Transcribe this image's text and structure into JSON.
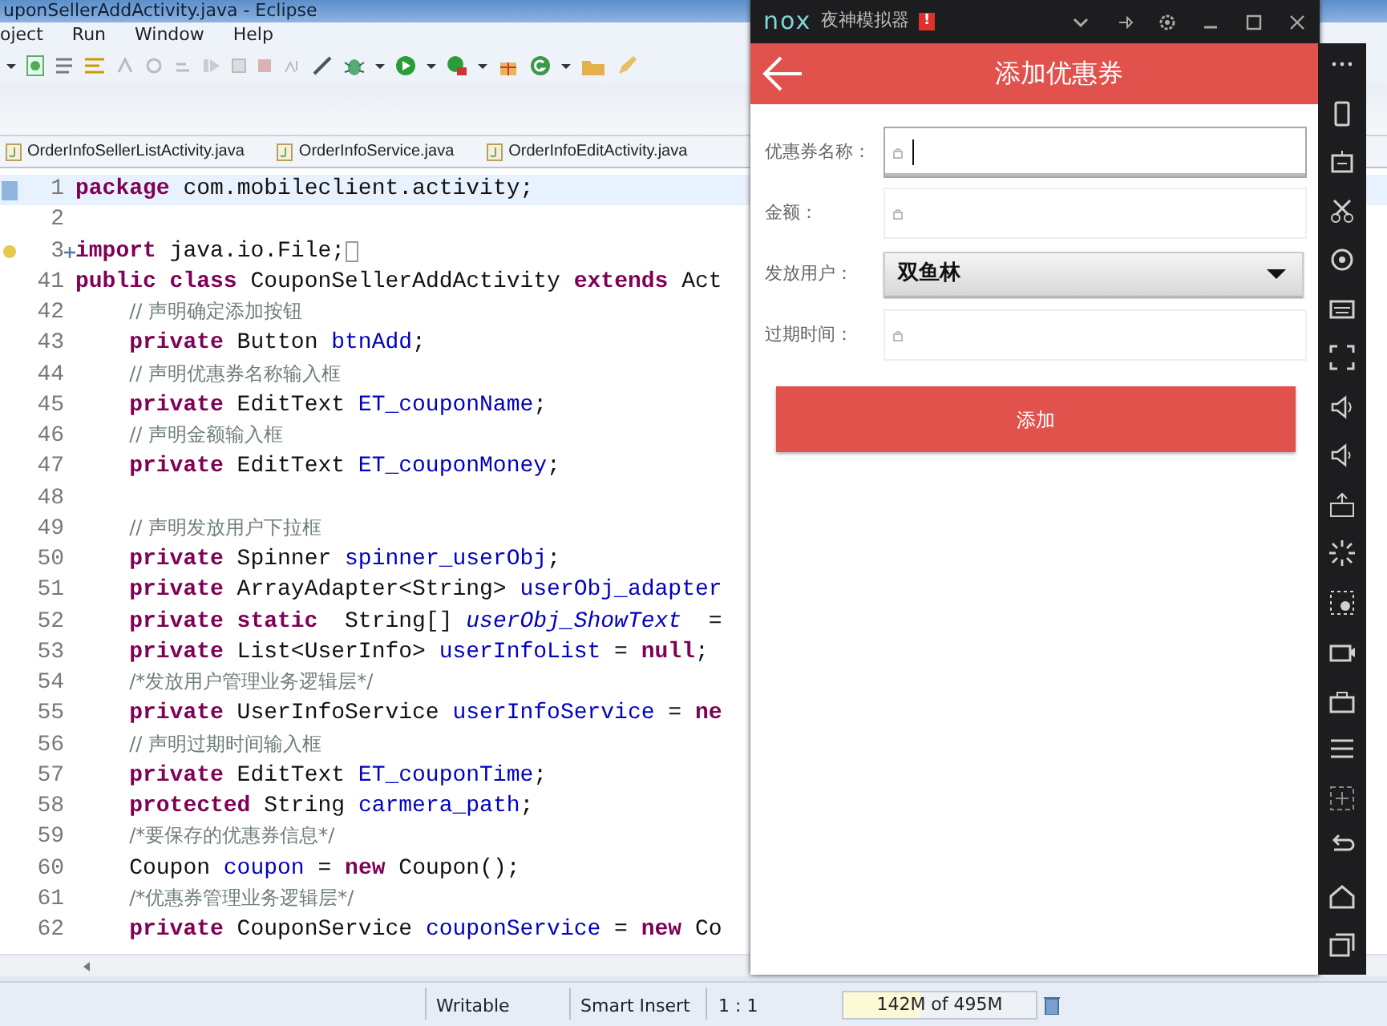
{
  "eclipse": {
    "title": "uponSellerAddActivity.java - Eclipse",
    "menu": [
      "oject",
      "Run",
      "Window",
      "Help"
    ],
    "tabs": [
      {
        "label": "OrderInfoSellerListActivity.java",
        "selected": false
      },
      {
        "label": "OrderInfoService.java",
        "selected": false
      },
      {
        "label": "OrderInfoEditActivity.java",
        "selected": false
      }
    ],
    "code_lines": [
      {
        "number": "1",
        "current": true,
        "indented": false,
        "segments": [
          {
            "kind": "keyword",
            "text": "package"
          },
          {
            "kind": "plain",
            "text": " com.mobileclient.activity;"
          }
        ]
      },
      {
        "number": "2",
        "current": false
      },
      {
        "number": "3",
        "current": false,
        "indented": false,
        "folded": true,
        "segments": [
          {
            "kind": "keyword",
            "text": "import"
          },
          {
            "kind": "plain",
            "text": " java.io.File;"
          }
        ]
      },
      {
        "number": "41",
        "current": false,
        "indented": false,
        "segments": [
          {
            "kind": "keyword",
            "text": "public class"
          },
          {
            "kind": "plain",
            "text": " CouponSellerAddActivity "
          },
          {
            "kind": "keyword",
            "text": "extends"
          },
          {
            "kind": "plain",
            "text": " Act"
          }
        ]
      },
      {
        "number": "42",
        "current": false,
        "indented": true,
        "segments": [
          {
            "kind": "comment",
            "text": "// 声明确定添加按钮"
          }
        ]
      },
      {
        "number": "43",
        "current": false,
        "indented": true,
        "segments": [
          {
            "kind": "keyword",
            "text": "private"
          },
          {
            "kind": "plain",
            "text": " Button "
          },
          {
            "kind": "field",
            "text": "btnAdd"
          },
          {
            "kind": "plain",
            "text": ";"
          }
        ]
      },
      {
        "number": "44",
        "current": false,
        "indented": true,
        "segments": [
          {
            "kind": "comment",
            "text": "// 声明优惠券名称输入框"
          }
        ]
      },
      {
        "number": "45",
        "current": false,
        "indented": true,
        "segments": [
          {
            "kind": "keyword",
            "text": "private"
          },
          {
            "kind": "plain",
            "text": " EditText "
          },
          {
            "kind": "field",
            "text": "ET_couponName"
          },
          {
            "kind": "plain",
            "text": ";"
          }
        ]
      },
      {
        "number": "46",
        "current": false,
        "indented": true,
        "segments": [
          {
            "kind": "comment",
            "text": "// 声明金额输入框"
          }
        ]
      },
      {
        "number": "47",
        "current": false,
        "indented": true,
        "segments": [
          {
            "kind": "keyword",
            "text": "private"
          },
          {
            "kind": "plain",
            "text": " EditText "
          },
          {
            "kind": "field",
            "text": "ET_couponMoney"
          },
          {
            "kind": "plain",
            "text": ";"
          }
        ]
      },
      {
        "number": "48",
        "current": false
      },
      {
        "number": "49",
        "current": false,
        "indented": true,
        "segments": [
          {
            "kind": "comment",
            "text": "// 声明发放用户下拉框"
          }
        ]
      },
      {
        "number": "50",
        "current": false,
        "indented": true,
        "segments": [
          {
            "kind": "keyword",
            "text": "private"
          },
          {
            "kind": "plain",
            "text": " Spinner "
          },
          {
            "kind": "field",
            "text": "spinner_userObj"
          },
          {
            "kind": "plain",
            "text": ";"
          }
        ]
      },
      {
        "number": "51",
        "current": false,
        "indented": true,
        "segments": [
          {
            "kind": "keyword",
            "text": "private"
          },
          {
            "kind": "plain",
            "text": " ArrayAdapter<String> "
          },
          {
            "kind": "field",
            "text": "userObj_adapter"
          }
        ]
      },
      {
        "number": "52",
        "current": false,
        "indented": true,
        "segments": [
          {
            "kind": "keyword",
            "text": "private static"
          },
          {
            "kind": "plain",
            "text": "  String[] "
          },
          {
            "kind": "static_field",
            "text": "userObj_ShowText"
          },
          {
            "kind": "plain",
            "text": "  ="
          }
        ]
      },
      {
        "number": "53",
        "current": false,
        "indented": true,
        "segments": [
          {
            "kind": "keyword",
            "text": "private"
          },
          {
            "kind": "plain",
            "text": " List<UserInfo> "
          },
          {
            "kind": "field",
            "text": "userInfoList"
          },
          {
            "kind": "plain",
            "text": " = "
          },
          {
            "kind": "keyword",
            "text": "null"
          },
          {
            "kind": "plain",
            "text": ";"
          }
        ]
      },
      {
        "number": "54",
        "current": false,
        "indented": true,
        "segments": [
          {
            "kind": "comment",
            "text": "/*发放用户管理业务逻辑层*/"
          }
        ]
      },
      {
        "number": "55",
        "current": false,
        "indented": true,
        "segments": [
          {
            "kind": "keyword",
            "text": "private"
          },
          {
            "kind": "plain",
            "text": " UserInfoService "
          },
          {
            "kind": "field",
            "text": "userInfoService"
          },
          {
            "kind": "plain",
            "text": " = "
          },
          {
            "kind": "keyword",
            "text": "ne"
          }
        ]
      },
      {
        "number": "56",
        "current": false,
        "indented": true,
        "segments": [
          {
            "kind": "comment",
            "text": "// 声明过期时间输入框"
          }
        ]
      },
      {
        "number": "57",
        "current": false,
        "indented": true,
        "segments": [
          {
            "kind": "keyword",
            "text": "private"
          },
          {
            "kind": "plain",
            "text": " EditText "
          },
          {
            "kind": "field",
            "text": "ET_couponTime"
          },
          {
            "kind": "plain",
            "text": ";"
          }
        ]
      },
      {
        "number": "58",
        "current": false,
        "indented": true,
        "segments": [
          {
            "kind": "keyword",
            "text": "protected"
          },
          {
            "kind": "plain",
            "text": " String "
          },
          {
            "kind": "field",
            "text": "carmera_path"
          },
          {
            "kind": "plain",
            "text": ";"
          }
        ]
      },
      {
        "number": "59",
        "current": false,
        "indented": true,
        "segments": [
          {
            "kind": "comment",
            "text": "/*要保存的优惠券信息*/"
          }
        ]
      },
      {
        "number": "60",
        "current": false,
        "indented": true,
        "segments": [
          {
            "kind": "plain",
            "text": "Coupon "
          },
          {
            "kind": "field",
            "text": "coupon"
          },
          {
            "kind": "plain",
            "text": " = "
          },
          {
            "kind": "keyword",
            "text": "new"
          },
          {
            "kind": "plain",
            "text": " Coupon();"
          }
        ]
      },
      {
        "number": "61",
        "current": false,
        "indented": true,
        "segments": [
          {
            "kind": "comment",
            "text": "/*优惠券管理业务逻辑层*/"
          }
        ]
      },
      {
        "number": "62",
        "current": false,
        "indented": true,
        "segments": [
          {
            "kind": "keyword",
            "text": "private"
          },
          {
            "kind": "plain",
            "text": " CouponService "
          },
          {
            "kind": "field",
            "text": "couponService"
          },
          {
            "kind": "plain",
            "text": " = "
          },
          {
            "kind": "keyword",
            "text": "new"
          },
          {
            "kind": "plain",
            "text": " Co"
          }
        ]
      }
    ],
    "status_bar": {
      "mode": "Writable",
      "insert": "Smart Insert",
      "position": "1 : 1",
      "heap": "142M of 495M"
    }
  },
  "emulator": {
    "logo": "nox",
    "title": "夜神模拟器",
    "alert": "!",
    "app_title": "添加优惠券",
    "fields": [
      {
        "label": "优惠券名称：",
        "kind": "text",
        "focused": true
      },
      {
        "label": "金额：",
        "kind": "text",
        "focused": false
      },
      {
        "label": "发放用户：",
        "kind": "spinner",
        "value": "双鱼林"
      },
      {
        "label": "过期时间：",
        "kind": "text",
        "focused": false
      }
    ],
    "submit": "添加"
  }
}
